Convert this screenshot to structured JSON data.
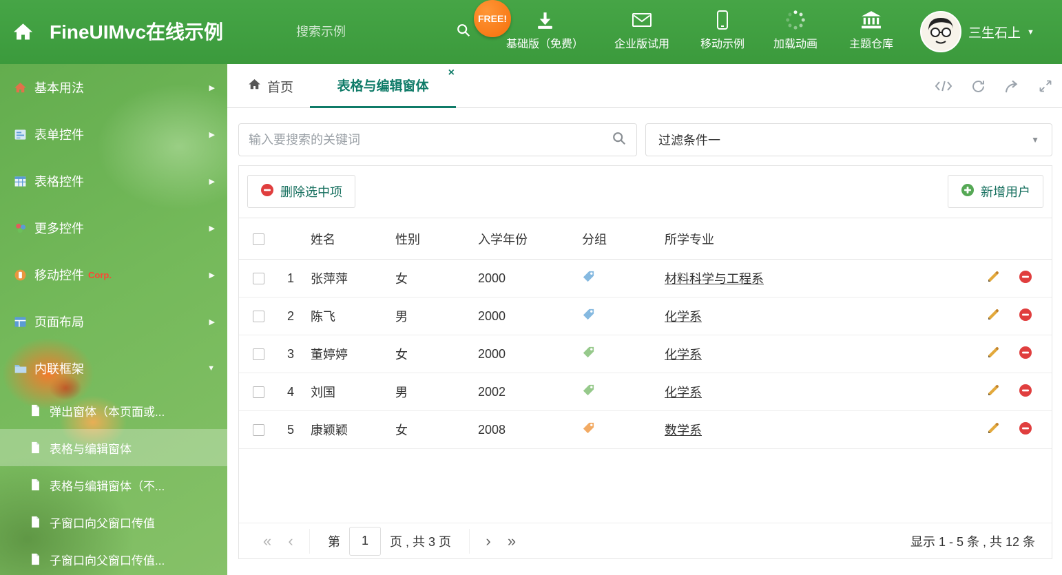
{
  "icons": {
    "caret_down": "▼",
    "arrow_right": "▶",
    "arrow_down": "▼",
    "close": "×",
    "first": "«",
    "prev": "‹",
    "next": "›",
    "last": "»"
  },
  "header": {
    "title": "FineUIMvc在线示例",
    "search_placeholder": "搜索示例",
    "free_badge": "FREE!",
    "nav": [
      {
        "label": "基础版（免费）"
      },
      {
        "label": "企业版试用"
      },
      {
        "label": "移动示例"
      },
      {
        "label": "加载动画"
      },
      {
        "label": "主题仓库"
      }
    ],
    "user_name": "三生石上"
  },
  "sidebar": {
    "items": [
      {
        "label": "基本用法"
      },
      {
        "label": "表单控件"
      },
      {
        "label": "表格控件"
      },
      {
        "label": "更多控件"
      },
      {
        "label": "移动控件",
        "badge": "Corp."
      },
      {
        "label": "页面布局"
      },
      {
        "label": "内联框架"
      }
    ],
    "subitems": [
      {
        "label": "弹出窗体（本页面或..."
      },
      {
        "label": "表格与编辑窗体"
      },
      {
        "label": "表格与编辑窗体（不..."
      },
      {
        "label": "子窗口向父窗口传值"
      },
      {
        "label": "子窗口向父窗口传值..."
      }
    ]
  },
  "tabs": {
    "home": "首页",
    "active": "表格与编辑窗体"
  },
  "filters": {
    "search_placeholder": "输入要搜索的关键词",
    "filter_selected": "过滤条件一"
  },
  "grid": {
    "delete_button": "删除选中项",
    "add_button": "新增用户",
    "columns": {
      "name": "姓名",
      "gender": "性别",
      "year": "入学年份",
      "group": "分组",
      "major": "所学专业"
    },
    "rows": [
      {
        "index": 1,
        "name": "张萍萍",
        "gender": "女",
        "year": "2000",
        "tag_color": "#85b9e0",
        "major": "材料科学与工程系"
      },
      {
        "index": 2,
        "name": "陈飞",
        "gender": "男",
        "year": "2000",
        "tag_color": "#85b9e0",
        "major": "化学系"
      },
      {
        "index": 3,
        "name": "董婷婷",
        "gender": "女",
        "year": "2000",
        "tag_color": "#96c98b",
        "major": "化学系"
      },
      {
        "index": 4,
        "name": "刘国",
        "gender": "男",
        "year": "2002",
        "tag_color": "#96c98b",
        "major": "化学系"
      },
      {
        "index": 5,
        "name": "康颖颖",
        "gender": "女",
        "year": "2008",
        "tag_color": "#f2aa63",
        "major": "数学系"
      }
    ],
    "pagination": {
      "prefix": "第",
      "page": "1",
      "suffix": "页 , 共 3 页",
      "summary": "显示 1 - 5 条 , 共 12 条"
    }
  }
}
